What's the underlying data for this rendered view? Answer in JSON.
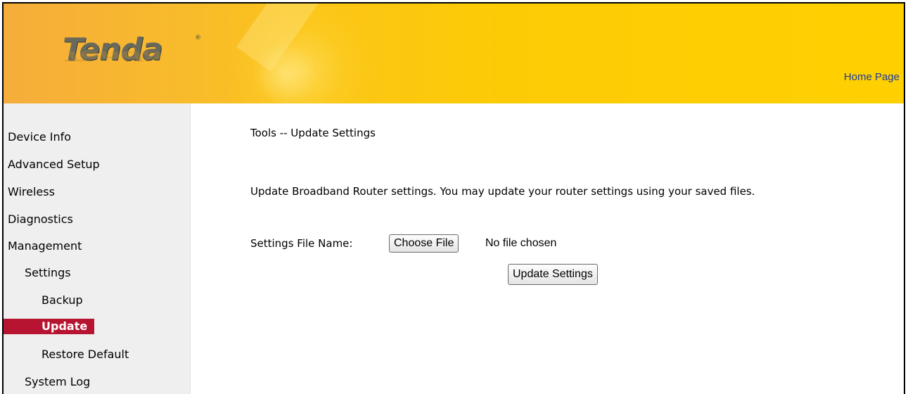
{
  "header": {
    "logo_text": "Tenda",
    "logo_reg_mark": "®",
    "home_link": "Home Page"
  },
  "sidebar": {
    "items": [
      {
        "label": "Device Info",
        "level": 0,
        "active": false
      },
      {
        "label": "Advanced Setup",
        "level": 0,
        "active": false
      },
      {
        "label": "Wireless",
        "level": 0,
        "active": false
      },
      {
        "label": "Diagnostics",
        "level": 0,
        "active": false
      },
      {
        "label": "Management",
        "level": 0,
        "active": false
      },
      {
        "label": "Settings",
        "level": 1,
        "active": false
      },
      {
        "label": "Backup",
        "level": 2,
        "active": false
      },
      {
        "label": "Update",
        "level": 2,
        "active": true
      },
      {
        "label": "Restore Default",
        "level": 2,
        "active": false
      },
      {
        "label": "System Log",
        "level": 1,
        "active": false
      }
    ]
  },
  "main": {
    "title": "Tools -- Update Settings",
    "description": "Update Broadband Router settings. You may update your router settings using your saved files.",
    "file_label": "Settings File Name:",
    "choose_file_label": "Choose File",
    "file_status": "No file chosen",
    "update_button_label": "Update Settings"
  },
  "colors": {
    "header_yellow": "#ffd000",
    "header_orange": "#f6ad3b",
    "active_nav": "#b71432",
    "sidebar_bg": "#efefef",
    "link": "#1e3ba0"
  }
}
